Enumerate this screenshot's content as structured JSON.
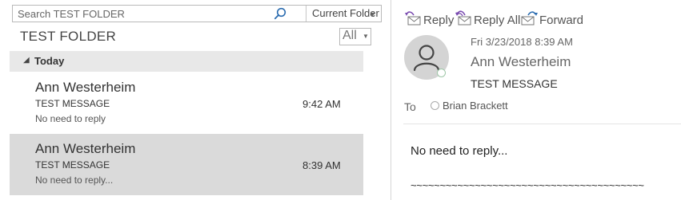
{
  "search": {
    "placeholder": "Search TEST FOLDER",
    "scope": "Current Folder"
  },
  "folder": {
    "title": "TEST FOLDER",
    "filter": "All"
  },
  "group": {
    "label": "Today"
  },
  "messages": [
    {
      "sender": "Ann Westerheim",
      "subject": "TEST MESSAGE",
      "time": "9:42 AM",
      "preview": "No need to reply"
    },
    {
      "sender": "Ann Westerheim",
      "subject": "TEST MESSAGE",
      "time": "8:39 AM",
      "preview": "No need to reply...",
      "selected": true
    }
  ],
  "reading": {
    "actions": {
      "reply": "Reply",
      "reply_all": "Reply All",
      "forward": "Forward"
    },
    "date": "Fri 3/23/2018 8:39 AM",
    "from": "Ann Westerheim",
    "subject": "TEST MESSAGE",
    "to_label": "To",
    "recipient": "Brian Brackett",
    "body": "No need to reply...",
    "signature": "~~~~~~~~~~~~~~~~~~~~~~~~~~~~~~~~~~~~~~~~"
  },
  "colors": {
    "group_header_bg": "#e8e8e8",
    "selected_row_bg": "#dadada",
    "search_icon": "#2b6cb0",
    "presence_ring": "#9fc7a8"
  },
  "icons": [
    "search-icon",
    "chevron-down-icon",
    "collapse-triangle-icon",
    "reply-icon",
    "reply-all-icon",
    "forward-icon",
    "contact-avatar-icon",
    "presence-status-icon",
    "recipient-status-icon"
  ]
}
